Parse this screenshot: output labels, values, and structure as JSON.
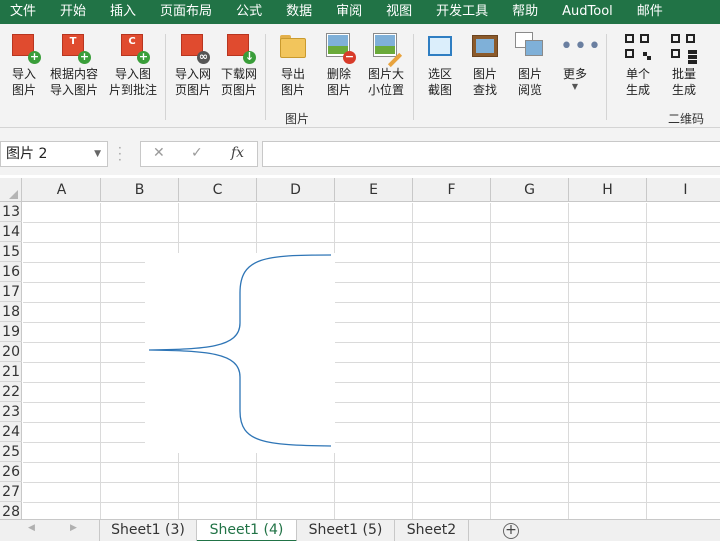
{
  "menu": [
    "文件",
    "开始",
    "插入",
    "页面布局",
    "公式",
    "数据",
    "审阅",
    "视图",
    "开发工具",
    "帮助",
    "AudTool",
    "邮件"
  ],
  "ribbon": {
    "buttons": [
      {
        "label": "导入\n图片",
        "icon": "import-picture-icon"
      },
      {
        "label": "根据内容\n导入图片",
        "icon": "import-by-content-icon"
      },
      {
        "label": "导入图\n片到批注",
        "icon": "import-to-comment-icon"
      },
      {
        "label": "导入网\n页图片",
        "icon": "import-web-picture-icon"
      },
      {
        "label": "下载网\n页图片",
        "icon": "download-web-picture-icon"
      },
      {
        "label": "导出\n图片",
        "icon": "export-picture-icon"
      },
      {
        "label": "删除\n图片",
        "icon": "delete-picture-icon"
      },
      {
        "label": "图片大\n小位置",
        "icon": "picture-size-position-icon"
      },
      {
        "label": "选区\n截图",
        "icon": "selection-screenshot-icon"
      },
      {
        "label": "图片\n查找",
        "icon": "picture-find-icon"
      },
      {
        "label": "图片\n阅览",
        "icon": "picture-browse-icon"
      },
      {
        "label": "更多",
        "icon": "more-icon"
      },
      {
        "label": "单个\n生成",
        "icon": "qr-single-icon"
      },
      {
        "label": "批量\n生成",
        "icon": "qr-batch-icon"
      }
    ],
    "groups": {
      "picture": "图片",
      "qrcode": "二维码"
    },
    "ico_letters": {
      "b1": "T",
      "b2": "C"
    }
  },
  "formula_bar": {
    "name_box": "图片 2",
    "cancel": "✕",
    "enter": "✓",
    "fx": "fx",
    "content": ""
  },
  "grid": {
    "columns": [
      "A",
      "B",
      "C",
      "D",
      "E",
      "F",
      "G",
      "H",
      "I"
    ],
    "rows": [
      "13",
      "14",
      "15",
      "16",
      "17",
      "18",
      "19",
      "20",
      "21",
      "22",
      "23",
      "24",
      "25",
      "26",
      "27",
      "28"
    ],
    "shape": {
      "type": "left-curly-brace",
      "stroke": "#2e75b6"
    }
  },
  "sheet_tabs": {
    "tabs": [
      "Sheet1 (3)",
      "Sheet1 (4)",
      "Sheet1 (5)",
      "Sheet2"
    ],
    "active": "Sheet1 (4)",
    "add_label": "+"
  },
  "colors": {
    "accent": "#217346",
    "ribbon_bg": "#f3f3f3",
    "shape_stroke": "#2e75b6"
  }
}
